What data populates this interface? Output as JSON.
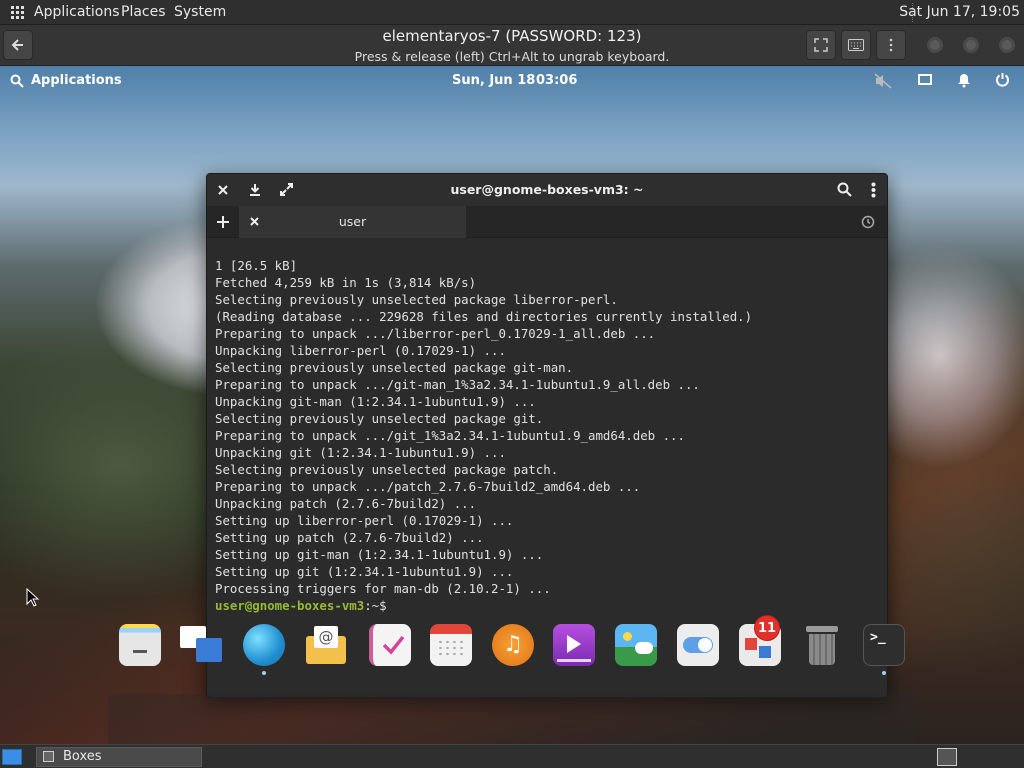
{
  "host_panel": {
    "menus": [
      "Applications",
      "Places",
      "System"
    ],
    "clock": "Sat Jun 17, 19:05"
  },
  "boxes": {
    "title": "elementaryos-7 (PASSWORD: 123)",
    "subtitle": "Press & release (left) Ctrl+Alt to ungrab keyboard."
  },
  "guest_panel": {
    "applications": "Applications",
    "date": "Sun, Jun 18",
    "time": "03:06"
  },
  "terminal": {
    "title": "user@gnome-boxes-vm3: ~",
    "tab_label": "user",
    "lines": [
      "1 [26.5 kB]",
      "Fetched 4,259 kB in 1s (3,814 kB/s)",
      "Selecting previously unselected package liberror-perl.",
      "(Reading database ... 229628 files and directories currently installed.)",
      "Preparing to unpack .../liberror-perl_0.17029-1_all.deb ...",
      "Unpacking liberror-perl (0.17029-1) ...",
      "Selecting previously unselected package git-man.",
      "Preparing to unpack .../git-man_1%3a2.34.1-1ubuntu1.9_all.deb ...",
      "Unpacking git-man (1:2.34.1-1ubuntu1.9) ...",
      "Selecting previously unselected package git.",
      "Preparing to unpack .../git_1%3a2.34.1-1ubuntu1.9_amd64.deb ...",
      "Unpacking git (1:2.34.1-1ubuntu1.9) ...",
      "Selecting previously unselected package patch.",
      "Preparing to unpack .../patch_2.7.6-7build2_amd64.deb ...",
      "Unpacking patch (2.7.6-7build2) ...",
      "Setting up liberror-perl (0.17029-1) ...",
      "Setting up patch (2.7.6-7build2) ...",
      "Setting up git-man (1:2.34.1-1ubuntu1.9) ...",
      "Setting up git (1:2.34.1-1ubuntu1.9) ...",
      "Processing triggers for man-db (2.10.2-1) ..."
    ],
    "prompt_user": "user@gnome-boxes-vm3",
    "prompt_path": ":~$"
  },
  "dock": {
    "items": [
      {
        "name": "files-icon",
        "color": "#d9d9d9"
      },
      {
        "name": "multitasking-view-icon",
        "color": "#3a7bd5"
      },
      {
        "name": "web-browser-icon",
        "color": "#2ea8d8"
      },
      {
        "name": "mail-icon",
        "color": "#f3c14b"
      },
      {
        "name": "tasks-icon",
        "color": "#ececec"
      },
      {
        "name": "calendar-icon",
        "color": "#e8e8e8"
      },
      {
        "name": "music-icon",
        "color": "#f39a23"
      },
      {
        "name": "videos-icon",
        "color": "#a63fd1"
      },
      {
        "name": "photos-icon",
        "color": "#4aa3e8"
      },
      {
        "name": "settings-icon",
        "color": "#f0f0f0"
      },
      {
        "name": "appcenter-icon",
        "color": "#e9e9e9"
      },
      {
        "name": "trash-icon",
        "color": "#8a8a8a"
      },
      {
        "name": "terminal-icon",
        "color": "#333333"
      }
    ],
    "appcenter_badge": "11"
  },
  "taskbar": {
    "item_label": "Boxes"
  }
}
